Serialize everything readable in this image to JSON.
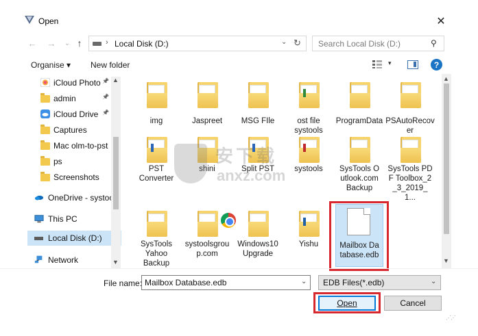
{
  "window": {
    "title": "Open",
    "close_glyph": "✕"
  },
  "nav": {
    "back_glyph": "←",
    "forward_glyph": "→",
    "recent_glyph": "⌄",
    "up_glyph": "↑",
    "address": {
      "separator": "›",
      "text": "Local Disk (D:)",
      "dropdown_glyph": "⌄",
      "refresh_glyph": "↻"
    },
    "search": {
      "placeholder": "Search Local Disk (D:)",
      "icon_glyph": "⚲"
    }
  },
  "toolbar": {
    "organise_label": "Organise ▾",
    "new_folder_label": "New folder",
    "view_dropdown_glyph": "▾",
    "help_glyph": "?"
  },
  "sidebar": {
    "items": [
      {
        "label": "iCloud Photo",
        "icon": "icloud-photos-icon",
        "pinned": true
      },
      {
        "label": "admin",
        "icon": "folder-icon",
        "pinned": true
      },
      {
        "label": "iCloud Drive",
        "icon": "icloud-drive-icon",
        "pinned": true
      },
      {
        "label": "Captures",
        "icon": "folder-icon",
        "pinned": false
      },
      {
        "label": "Mac olm-to-pst",
        "icon": "folder-icon",
        "pinned": false
      },
      {
        "label": "ps",
        "icon": "folder-icon",
        "pinned": false
      },
      {
        "label": "Screenshots",
        "icon": "folder-icon",
        "pinned": false
      },
      {
        "label": "OneDrive - systoo",
        "icon": "onedrive-icon",
        "pinned": false
      },
      {
        "label": "This PC",
        "icon": "pc-icon",
        "pinned": false
      },
      {
        "label": "Local Disk (D:)",
        "icon": "drive-icon",
        "pinned": false
      },
      {
        "label": "Network",
        "icon": "network-icon",
        "pinned": false
      }
    ],
    "pin_glyph": "📌",
    "scroll_up": "▲",
    "scroll_down": "▼"
  },
  "files": [
    {
      "name": "img",
      "type": "folder"
    },
    {
      "name": "Jaspreet",
      "type": "folder"
    },
    {
      "name": "MSG FIle",
      "type": "folder"
    },
    {
      "name": "ost file systools",
      "type": "folder"
    },
    {
      "name": "ProgramData",
      "type": "folder"
    },
    {
      "name": "PSAutoRecover",
      "type": "folder"
    },
    {
      "name": "PST Converter",
      "type": "folder"
    },
    {
      "name": "shini",
      "type": "folder"
    },
    {
      "name": "Split PST",
      "type": "folder"
    },
    {
      "name": "systools",
      "type": "folder"
    },
    {
      "name": "SysTools Outlook.com Backup",
      "type": "folder"
    },
    {
      "name": "SysTools PDF Toolbox_2_3_2019_1...",
      "type": "folder"
    },
    {
      "name": "SysTools Yahoo Backup",
      "type": "folder"
    },
    {
      "name": "systoolsgroup.com",
      "type": "folder"
    },
    {
      "name": "Windows10 Upgrade",
      "type": "folder"
    },
    {
      "name": "Yishu",
      "type": "folder"
    },
    {
      "name": "Mailbox Database.edb",
      "type": "file",
      "selected": true
    }
  ],
  "content_scroll": {
    "up": "▲",
    "down": "▼"
  },
  "bottom": {
    "file_name_label": "File name:",
    "file_name_value": "Mailbox Database.edb",
    "file_type_value": "EDB Files(*.edb)",
    "dropdown_glyph": "⌄",
    "open_label": "Open",
    "cancel_label": "Cancel"
  },
  "watermark": {
    "text_cn": "安下载",
    "text_en": "anxz.com"
  },
  "colors": {
    "accent": "#0078d7",
    "highlight_red": "#d7282f",
    "selection": "#cce4f7",
    "folder": "#f2c94c"
  }
}
